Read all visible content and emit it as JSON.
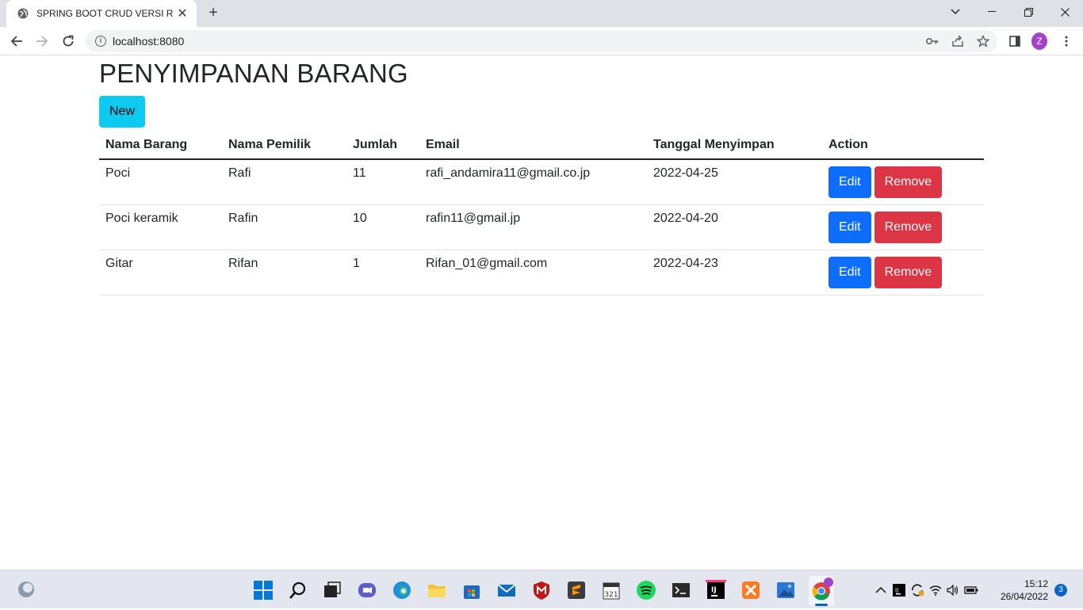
{
  "browser": {
    "tab_title": "SPRING BOOT CRUD VERSI RAFI",
    "tab_close": "✕",
    "new_tab": "+",
    "url": "localhost:8080",
    "profile_initial": "Z"
  },
  "page": {
    "title": "PENYIMPANAN BARANG",
    "new_button": "New",
    "columns": [
      "Nama Barang",
      "Nama Pemilik",
      "Jumlah",
      "Email",
      "Tanggal Menyimpan",
      "Action"
    ],
    "rows": [
      {
        "nama_barang": "Poci",
        "nama_pemilik": "Rafi",
        "jumlah": "11",
        "email": "rafi_andamira11@gmail.co.jp",
        "tanggal": "2022-04-25"
      },
      {
        "nama_barang": "Poci keramik",
        "nama_pemilik": "Rafin",
        "jumlah": "10",
        "email": "rafin11@gmail.jp",
        "tanggal": "2022-04-20"
      },
      {
        "nama_barang": "Gitar",
        "nama_pemilik": "Rifan",
        "jumlah": "1",
        "email": "Rifan_01@gmail.com",
        "tanggal": "2022-04-23"
      }
    ],
    "edit_label": "Edit",
    "remove_label": "Remove"
  },
  "taskbar": {
    "time": "15:12",
    "date": "26/04/2022",
    "notifications": "3",
    "chrome_badge": "Z"
  },
  "colors": {
    "new_button": "#0dcaf0",
    "edit_button": "#0d6efd",
    "remove_button": "#dc3545"
  }
}
